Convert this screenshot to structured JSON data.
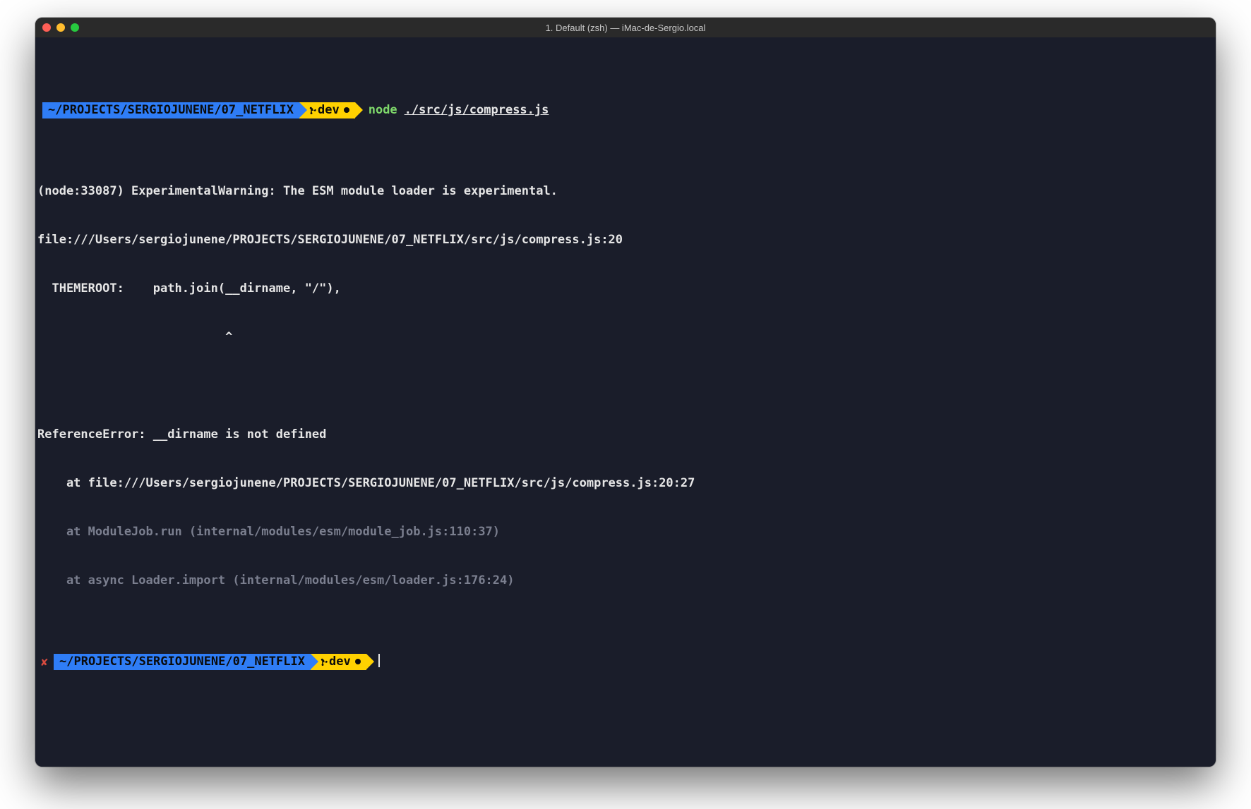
{
  "window": {
    "title": "1. Default (zsh) — iMac-de-Sergio.local"
  },
  "prompt1": {
    "path": "~/PROJECTS/SERGIOJUNENE/07_NETFLIX",
    "branch": "dev",
    "command_bin": "node",
    "command_arg": "./src/js/compress.js"
  },
  "output": {
    "l1": "(node:33087) ExperimentalWarning: The ESM module loader is experimental.",
    "l2": "file:///Users/sergiojunene/PROJECTS/SERGIOJUNENE/07_NETFLIX/src/js/compress.js:20",
    "l3": "  THEMEROOT:    path.join(__dirname, \"/\"),",
    "l4": "                          ^",
    "l5": "",
    "l6": "ReferenceError: __dirname is not defined",
    "l7": "    at file:///Users/sergiojunene/PROJECTS/SERGIOJUNENE/07_NETFLIX/src/js/compress.js:20:27",
    "l8": "    at ModuleJob.run (internal/modules/esm/module_job.js:110:37)",
    "l9": "    at async Loader.import (internal/modules/esm/loader.js:176:24)"
  },
  "prompt2": {
    "status": "✘",
    "path": "~/PROJECTS/SERGIOJUNENE/07_NETFLIX",
    "branch": "dev"
  }
}
